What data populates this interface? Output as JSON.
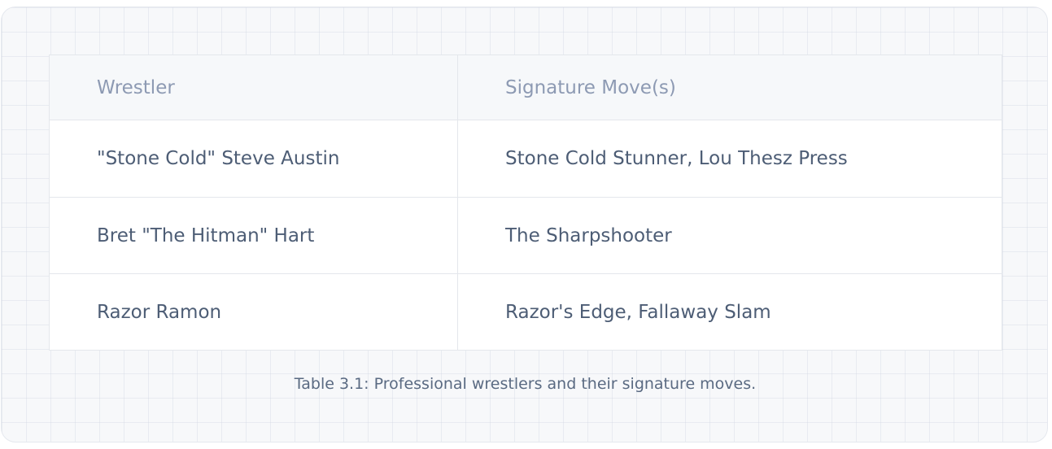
{
  "table": {
    "headers": [
      "Wrestler",
      "Signature Move(s)"
    ],
    "rows": [
      [
        "\"Stone Cold\" Steve Austin",
        "Stone Cold Stunner, Lou Thesz Press"
      ],
      [
        "Bret \"The Hitman\" Hart",
        "The Sharpshooter"
      ],
      [
        "Razor Ramon",
        "Razor's Edge, Fallaway Slam"
      ]
    ],
    "caption": "Table 3.1: Professional wrestlers and their signature moves."
  }
}
